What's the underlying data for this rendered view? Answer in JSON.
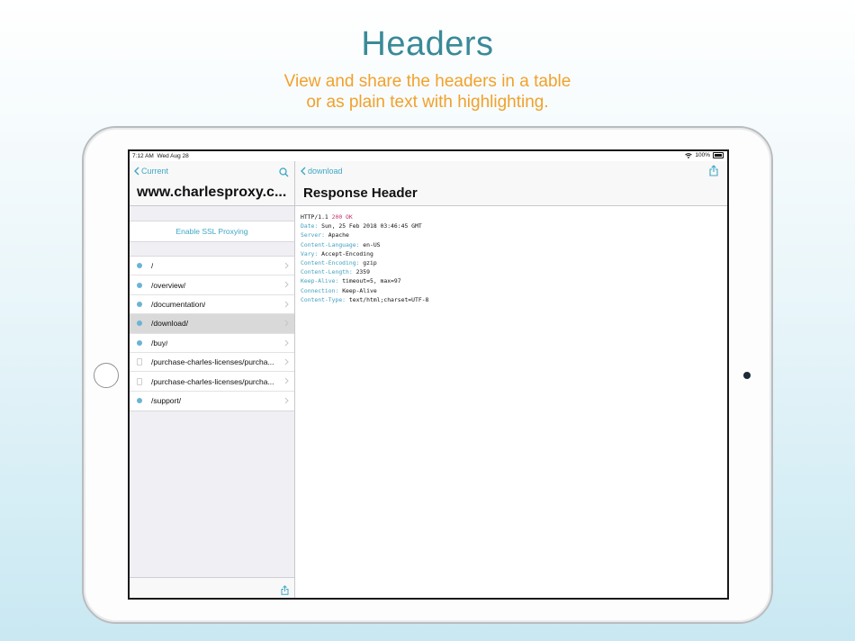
{
  "marketing": {
    "title": "Headers",
    "subtitle_line1": "View and share the headers in a table",
    "subtitle_line2": "or as plain text with highlighting."
  },
  "statusbar": {
    "time": "7:12 AM",
    "date": "Wed Aug 28",
    "battery": "100%"
  },
  "master": {
    "back_label": "Current",
    "host_title": "www.charlesproxy.c...",
    "ssl_button": "Enable SSL Proxying",
    "paths": [
      {
        "label": "/",
        "icon": "globe-icon",
        "selected": false
      },
      {
        "label": "/overview/",
        "icon": "globe-icon",
        "selected": false
      },
      {
        "label": "/documentation/",
        "icon": "globe-icon",
        "selected": false
      },
      {
        "label": "/download/",
        "icon": "globe-icon",
        "selected": true
      },
      {
        "label": "/buy/",
        "icon": "globe-icon",
        "selected": false
      },
      {
        "label": "/purchase-charles-licenses/purcha...",
        "icon": "document-icon",
        "selected": false
      },
      {
        "label": "/purchase-charles-licenses/purcha...",
        "icon": "document-icon",
        "selected": false
      },
      {
        "label": "/support/",
        "icon": "globe-icon",
        "selected": false
      }
    ]
  },
  "detail": {
    "back_label": "download",
    "title": "Response Header",
    "status_line": {
      "protocol": "HTTP/1.1",
      "status": "200 OK"
    },
    "headers": [
      {
        "key": "Date:",
        "value": "Sun, 25 Feb 2018 03:46:45 GMT"
      },
      {
        "key": "Server:",
        "value": "Apache"
      },
      {
        "key": "Content-Language:",
        "value": "en-US"
      },
      {
        "key": "Vary:",
        "value": "Accept-Encoding"
      },
      {
        "key": "Content-Encoding:",
        "value": "gzip"
      },
      {
        "key": "Content-Length:",
        "value": "2359"
      },
      {
        "key": "Keep-Alive:",
        "value": "timeout=5, max=97"
      },
      {
        "key": "Connection:",
        "value": "Keep-Alive"
      },
      {
        "key": "Content-Type:",
        "value": "text/html;charset=UTF-8"
      }
    ]
  },
  "colors": {
    "accent": "#3ea7c5",
    "title": "#3a8a98",
    "subtitle": "#f1a12c",
    "header_key": "#3f9fbf",
    "status_code": "#c0306d"
  }
}
